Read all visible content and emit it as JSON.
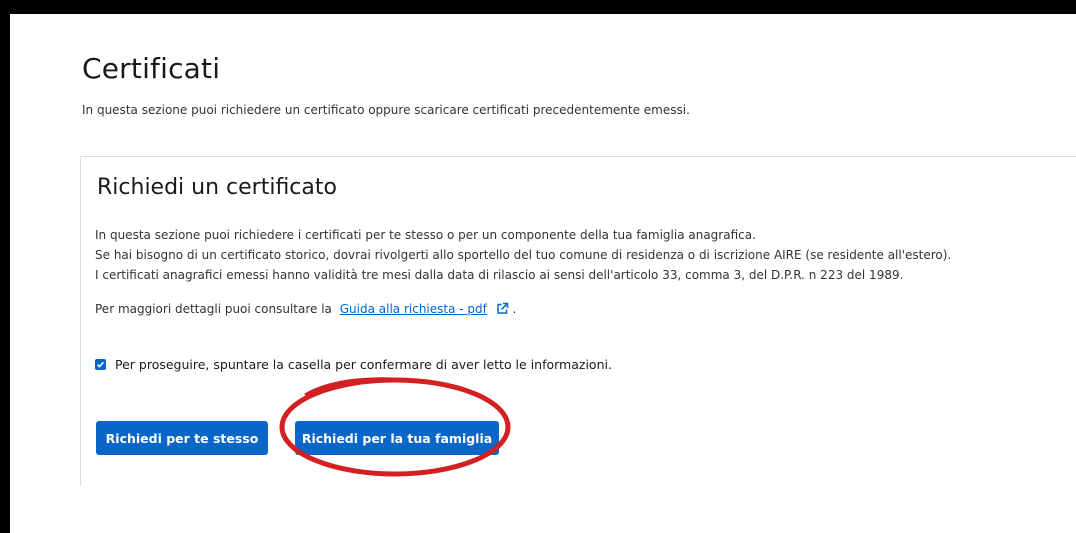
{
  "page": {
    "title": "Certificati",
    "intro": "In questa sezione puoi richiedere un certificato oppure scaricare certificati precedentemente emessi."
  },
  "request_section": {
    "title": "Richiedi un certificato",
    "description": [
      "In questa sezione puoi richiedere i certificati per te stesso o per un componente della tua famiglia anagrafica.",
      "Se hai bisogno di un certificato storico, dovrai rivolgerti allo sportello del tuo comune di residenza o di iscrizione AIRE (se residente all'estero).",
      "I certificati anagrafici emessi hanno validità tre mesi dalla data di rilascio ai sensi dell'articolo 33, comma 3, del D.P.R. n 223 del 1989."
    ],
    "guide_prefix": "Per maggiori dettagli puoi consultare la",
    "guide_link": "Guida alla richiesta - pdf",
    "guide_suffix": ".",
    "confirm_label": "Per proseguire, spuntare la casella per confermare di aver letto le informazioni.",
    "confirm_checked": true,
    "buttons": {
      "self": "Richiedi per te stesso",
      "family": "Richiedi per la tua famiglia"
    }
  },
  "colors": {
    "primary": "#0a66c8",
    "link": "#0066cc",
    "annotation": "#d42020"
  },
  "icons": {
    "external_link": "external-link-icon",
    "checkmark": "checkmark-icon"
  }
}
